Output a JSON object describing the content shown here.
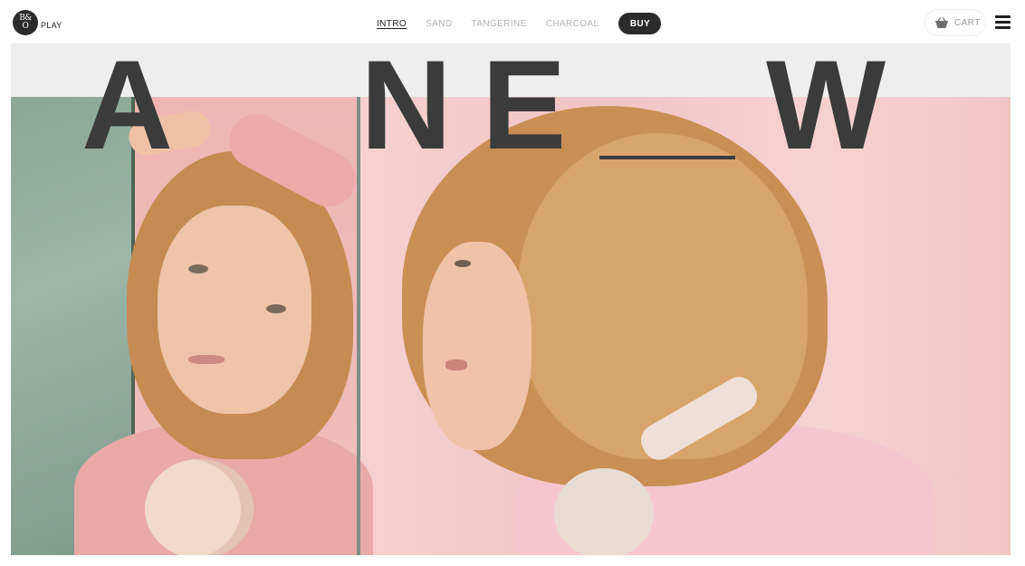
{
  "brand": {
    "logo_top": "B&",
    "logo_bottom": "O",
    "logo_text": "PLAY"
  },
  "nav": {
    "items": [
      {
        "label": "INTRO",
        "active": true
      },
      {
        "label": "SAND",
        "active": false
      },
      {
        "label": "TANGERINE",
        "active": false
      },
      {
        "label": "CHARCOAL",
        "active": false
      }
    ],
    "buy_label": "BUY"
  },
  "cart": {
    "icon": "basket-icon",
    "label": "CART"
  },
  "menu": {
    "icon": "hamburger-menu-icon"
  },
  "hero": {
    "headline_letters": [
      "A",
      "N",
      "E",
      "W"
    ],
    "image_description_colors": {
      "wall_green": "#8aa797",
      "backdrop_pink": "#f2c7c7",
      "hair_blonde": "#c98f55",
      "headphones_cream": "#efdfd6"
    }
  }
}
